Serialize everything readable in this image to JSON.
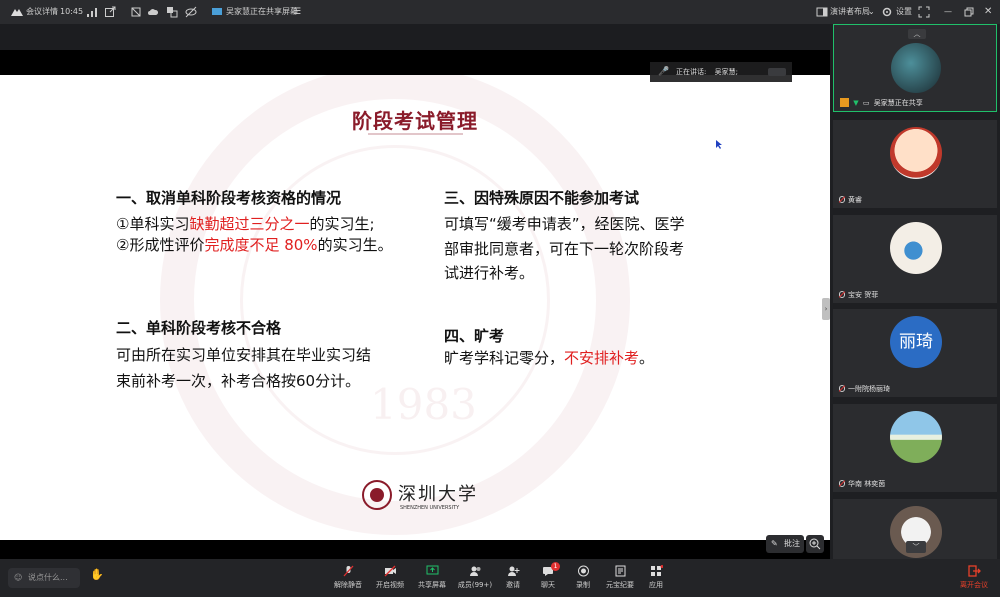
{
  "topbar": {
    "app_name": "会议详情",
    "time": "10:45",
    "sharing_status": "吴家慧正在共享屏幕",
    "layout_label": "演讲者布局",
    "settings_label": "设置"
  },
  "slide": {
    "title": "阶段考试管理",
    "sections": [
      {
        "heading": "一、取消单科阶段考核资格的情况",
        "line1_a": "①单科实习",
        "line1_red": "缺勤超过三分之一",
        "line1_b": "的实习生;",
        "line2_a": "②形成性评价",
        "line2_red": "完成度不足 80%",
        "line2_b": "的实习生。"
      },
      {
        "heading": "二、单科阶段考核不合格",
        "line1": "可由所在实习单位安排其在毕业实习结",
        "line2": "束前补考一次，补考合格按60分计。"
      },
      {
        "heading": "三、因特殊原因不能参加考试",
        "line1": "可填写“缓考申请表”，经医院、医学",
        "line2": "部审批同意者，可在下一轮次阶段考",
        "line3": "试进行补考。"
      },
      {
        "heading": "四、旷考",
        "line_a": "旷考学科记零分，",
        "line_red": "不安排补考",
        "line_b": "。"
      }
    ],
    "logo_cn": "深圳大学",
    "logo_en": "SHENZHEN UNIVERSITY",
    "watermark_year": "1983"
  },
  "speaking": {
    "label": "正在讲话:",
    "name": "吴家慧;"
  },
  "annotate_label": "批注",
  "participants": [
    {
      "name": "吴家慧正在共享",
      "avatar_text": ""
    },
    {
      "name": "黄睿",
      "avatar_text": ""
    },
    {
      "name": "宝安 贺菲",
      "avatar_text": ""
    },
    {
      "name": "一附院杨丽琦",
      "avatar_text": "丽琦"
    },
    {
      "name": "华南 林奕茵",
      "avatar_text": ""
    }
  ],
  "bottombar": {
    "say_placeholder": "说点什么...",
    "mute": "解除静音",
    "video": "开启视频",
    "share": "共享屏幕",
    "members": "成员(99+)",
    "invite": "邀请",
    "chat": "聊天",
    "chat_badge": "1",
    "record": "录制",
    "minutes": "元宝纪要",
    "apps": "应用",
    "leave": "离开会议"
  },
  "colors": {
    "accent_green": "#20c06a",
    "red": "#e02020",
    "leave_red": "#e8402a",
    "avatar_blue": "#2b6cc4"
  }
}
